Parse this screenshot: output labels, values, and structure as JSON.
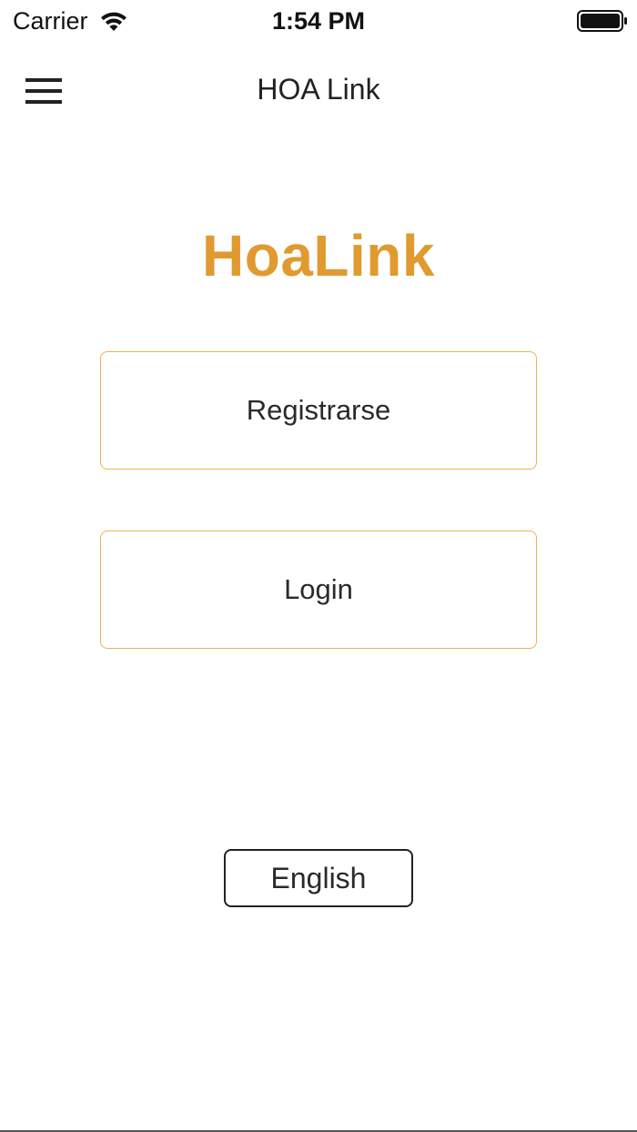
{
  "status_bar": {
    "carrier": "Carrier",
    "time": "1:54 PM",
    "icons": [
      "wifi-icon",
      "battery-icon"
    ]
  },
  "nav": {
    "title": "HOA Link",
    "menu_icon": "hamburger-menu-icon"
  },
  "brand": {
    "name": "HoaLink",
    "color": "#e09a2f"
  },
  "actions": {
    "register_label": "Registrarse",
    "login_label": "Login",
    "border_color": "#e9b453"
  },
  "language": {
    "toggle_label": "English"
  }
}
